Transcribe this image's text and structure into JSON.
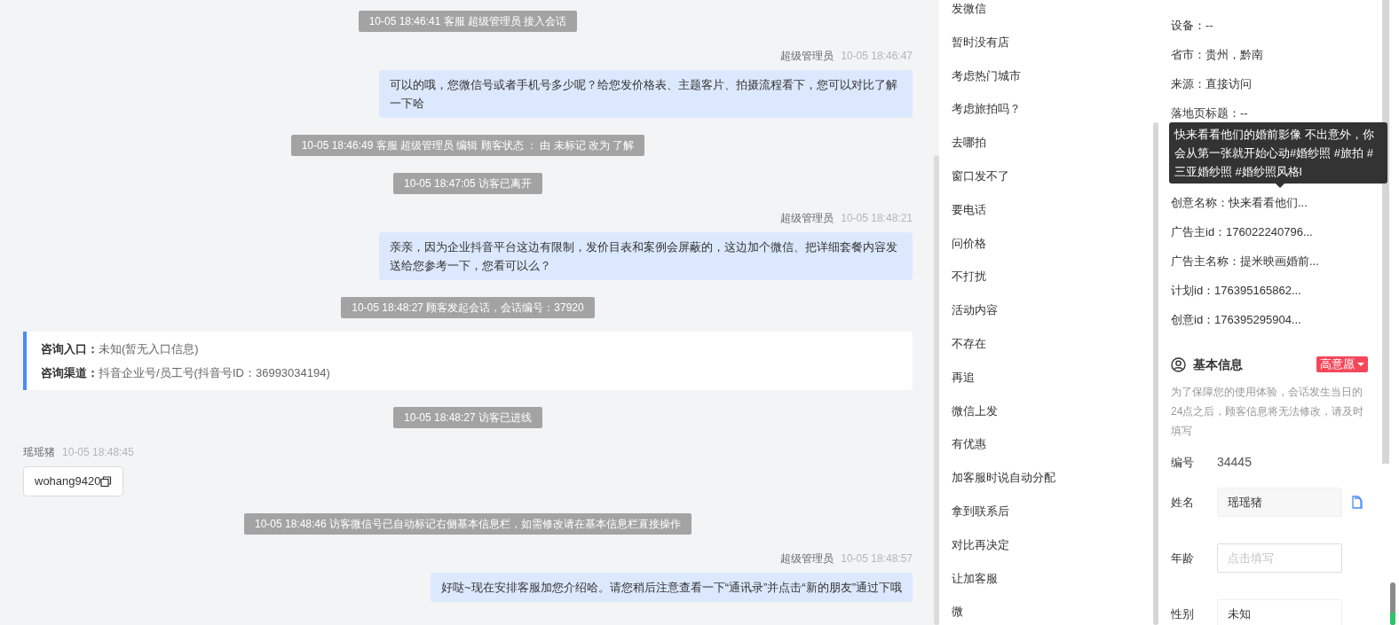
{
  "chat": {
    "messages": [
      {
        "kind": "system",
        "text": "10-05 18:46:41 客服 超级管理员 接入会话"
      },
      {
        "kind": "agent",
        "sender": "超级管理员",
        "time": "10-05 18:46:47",
        "text": "可以的哦，您微信号或者手机号多少呢？给您发价格表、主题客片、拍摄流程看下，您可以对比了解一下哈"
      },
      {
        "kind": "system",
        "text": "10-05 18:46:49 客服 超级管理员 编辑 顾客状态 ： 由 未标记 改为 了解"
      },
      {
        "kind": "system",
        "text": "10-05 18:47:05 访客已离开"
      },
      {
        "kind": "agent",
        "sender": "超级管理员",
        "time": "10-05 18:48:21",
        "text": "亲亲，因为企业抖音平台这边有限制，发价目表和案例会屏蔽的，这边加个微信、把详细套餐内容发送给您参考一下，您看可以么？"
      },
      {
        "kind": "system",
        "text": "10-05 18:48:27 顾客发起会话，会话编号：37920"
      },
      {
        "kind": "info",
        "rows": [
          {
            "label": "咨询入口：",
            "value": "未知(暂无入口信息)"
          },
          {
            "label": "咨询渠道：",
            "value": "抖音企业号/员工号(抖音号ID：36993034194)"
          }
        ]
      },
      {
        "kind": "system",
        "text": "10-05 18:48:27 访客已进线"
      },
      {
        "kind": "visitor",
        "sender": "瑶瑶猪",
        "time": "10-05 18:48:45",
        "text": "wohang9420"
      },
      {
        "kind": "system",
        "text": "10-05 18:48:46 访客微信号已自动标记右侧基本信息栏，如需修改请在基本信息栏直接操作"
      },
      {
        "kind": "agent",
        "sender": "超级管理员",
        "time": "10-05 18:48:57",
        "text": "好哒~现在安排客服加您介绍哈。请您稍后注意查看一下“通讯录”并点击“新的朋友”通过下哦"
      }
    ]
  },
  "quick_replies": [
    "发微信",
    "暂时没有店",
    "考虑热门城市",
    "考虑旅拍吗？",
    "去哪拍",
    "窗口发不了",
    "要电话",
    "问价格",
    "不打扰",
    "活动内容",
    "不存在",
    "再追",
    "微信上发",
    "有优惠",
    "加客服时说自动分配",
    "拿到联系后",
    "对比再决定",
    "让加客服",
    "微"
  ],
  "visitor_details": {
    "rows": [
      {
        "kind": "row",
        "text": "设备：--"
      },
      {
        "kind": "row",
        "text": "省市：贵州，黔南"
      },
      {
        "kind": "row",
        "text": "来源：直接访问"
      },
      {
        "kind": "row",
        "text": "落地页标题：--"
      },
      {
        "kind": "tooltip",
        "text": "快来看看他们的婚前影像 不出意外，你会从第一张就开始心动#婚纱照 #旅拍 #三亚婚纱照 #婚纱照风格l"
      },
      {
        "kind": "row",
        "text": "创意名称：快来看看他们..."
      },
      {
        "kind": "row",
        "text": "广告主id：176022240796..."
      },
      {
        "kind": "row",
        "text": "广告主名称：提米映画婚前..."
      },
      {
        "kind": "row",
        "text": "计划id：176395165862..."
      },
      {
        "kind": "row",
        "text": "创意id：176395295904..."
      }
    ]
  },
  "basic_info": {
    "title": "基本信息",
    "intent_badge": "高意愿",
    "note": "为了保障您的使用体验，会话发生当日的24点之后，顾客信息将无法修改，请及时填写",
    "fields": [
      {
        "kind": "text",
        "label": "编号",
        "value": "34445"
      },
      {
        "kind": "copyable",
        "label": "姓名",
        "value": "瑶瑶猪"
      },
      {
        "kind": "input",
        "label": "年龄",
        "placeholder": "点击填写"
      },
      {
        "kind": "select",
        "label": "性别",
        "value": "未知"
      }
    ]
  }
}
